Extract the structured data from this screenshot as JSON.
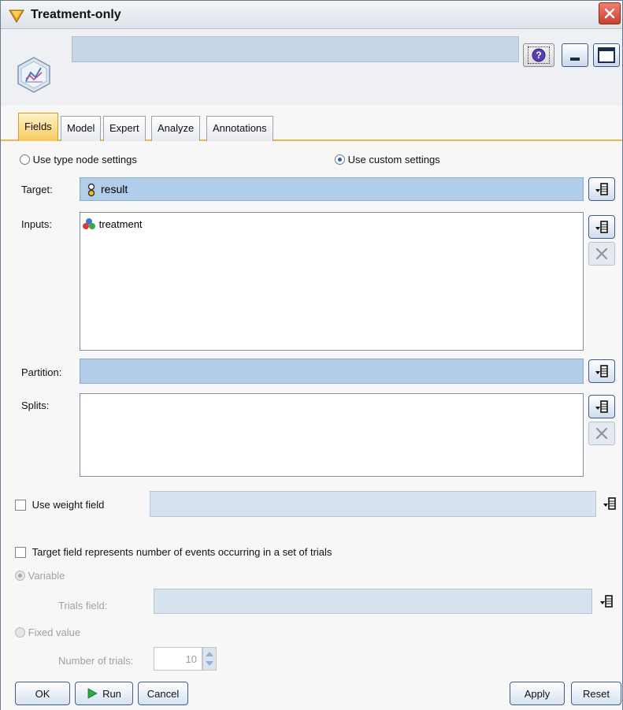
{
  "window": {
    "title": "Treatment-only"
  },
  "tabs": [
    "Fields",
    "Model",
    "Expert",
    "Analyze",
    "Annotations"
  ],
  "settings_mode": {
    "type_node_label": "Use type node settings",
    "custom_label": "Use custom settings",
    "selected": "custom"
  },
  "target": {
    "label": "Target:",
    "value": "result"
  },
  "inputs": {
    "label": "Inputs:",
    "items": [
      "treatment"
    ]
  },
  "partition": {
    "label": "Partition:",
    "value": ""
  },
  "splits": {
    "label": "Splits:",
    "items": []
  },
  "weight": {
    "label": "Use weight field",
    "checked": false,
    "value": ""
  },
  "events": {
    "label": "Target field represents number of events occurring in a set of trials",
    "checked": false
  },
  "variable": {
    "label": "Variable",
    "trials_label": "Trials field:",
    "value": ""
  },
  "fixed": {
    "label": "Fixed value",
    "num_trials_label": "Number of trials:",
    "num_trials": "10"
  },
  "buttons": {
    "ok": "OK",
    "run": "Run",
    "cancel": "Cancel",
    "apply": "Apply",
    "reset": "Reset"
  }
}
